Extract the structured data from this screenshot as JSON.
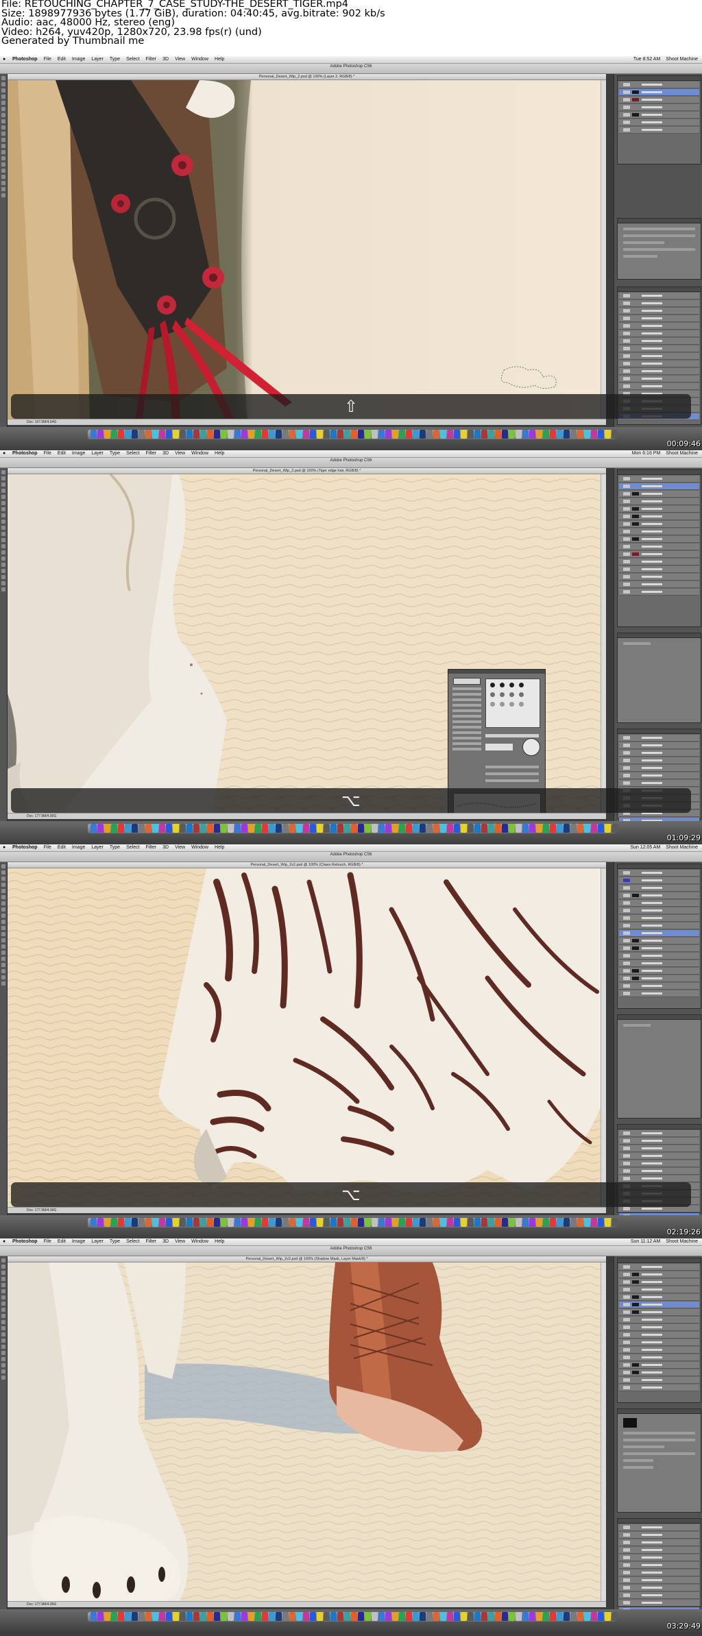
{
  "header": {
    "file": "File: RETOUCHING_CHAPTER_7_CASE_STUDY-THE_DESERT_TIGER.mp4",
    "size": "Size: 1898977936 bytes (1.77 GiB), duration: 04:40:45, avg.bitrate: 902 kb/s",
    "audio": "Audio: aac, 48000 Hz, stereo (eng)",
    "video": "Video: h264, yuv420p, 1280x720, 23.98 fps(r) (und)",
    "generated": "Generated by Thumbnail me"
  },
  "frames": [
    {
      "menu": [
        "Photoshop",
        "File",
        "Edit",
        "Image",
        "Layer",
        "Type",
        "Select",
        "Filter",
        "3D",
        "View",
        "Window",
        "Help"
      ],
      "window_title": "Adobe Photoshop CS6",
      "doc_title": "Personal_Desert_Wip_2.psd @ 100% (Layer 2, RGB/8) *",
      "clock": "Tue 8:52 AM",
      "user": "Shoot Machine",
      "status": "Doc: 167.0M/4.64G",
      "shortcut_key": "⇧",
      "timestamp": "00:09:46"
    },
    {
      "menu": [
        "Photoshop",
        "File",
        "Edit",
        "Image",
        "Layer",
        "Type",
        "Select",
        "Filter",
        "3D",
        "View",
        "Window",
        "Help"
      ],
      "window_title": "Adobe Photoshop CS6",
      "doc_title": "Personal_Desert_Wip_2.psd @ 100% (Tiger edge hair, RGB/8) *",
      "clock": "Mon 6:16 PM",
      "user": "Shoot Machine",
      "status": "Doc: 177.9M/4.90G",
      "shortcut_key": "⌥",
      "timestamp": "01:09:29"
    },
    {
      "menu": [
        "Photoshop",
        "File",
        "Edit",
        "Image",
        "Layer",
        "Type",
        "Select",
        "Filter",
        "3D",
        "View",
        "Window",
        "Help"
      ],
      "window_title": "Adobe Photoshop CS6",
      "doc_title": "Personal_Desert_Wip_2v2.psd @ 100% (Claws Retouch, RGB/8) *",
      "clock": "Sun 12:05 AM",
      "user": "Shoot Machine",
      "status": "Doc: 177.9M/4.99G",
      "shortcut_key": "⌥",
      "timestamp": "02:19:26"
    },
    {
      "menu": [
        "Photoshop",
        "File",
        "Edit",
        "Image",
        "Layer",
        "Type",
        "Select",
        "Filter",
        "3D",
        "View",
        "Window",
        "Help"
      ],
      "window_title": "Adobe Photoshop CS6",
      "doc_title": "Personal_Desert_Wip_2v2.psd @ 100% (Shadow Mask, Layer Mask/8) *",
      "clock": "Sun 11:12 AM",
      "user": "Shoot Machine",
      "status": "Doc: 177.9M/4.99G",
      "shortcut_key": "",
      "timestamp": "03:29:49"
    }
  ]
}
